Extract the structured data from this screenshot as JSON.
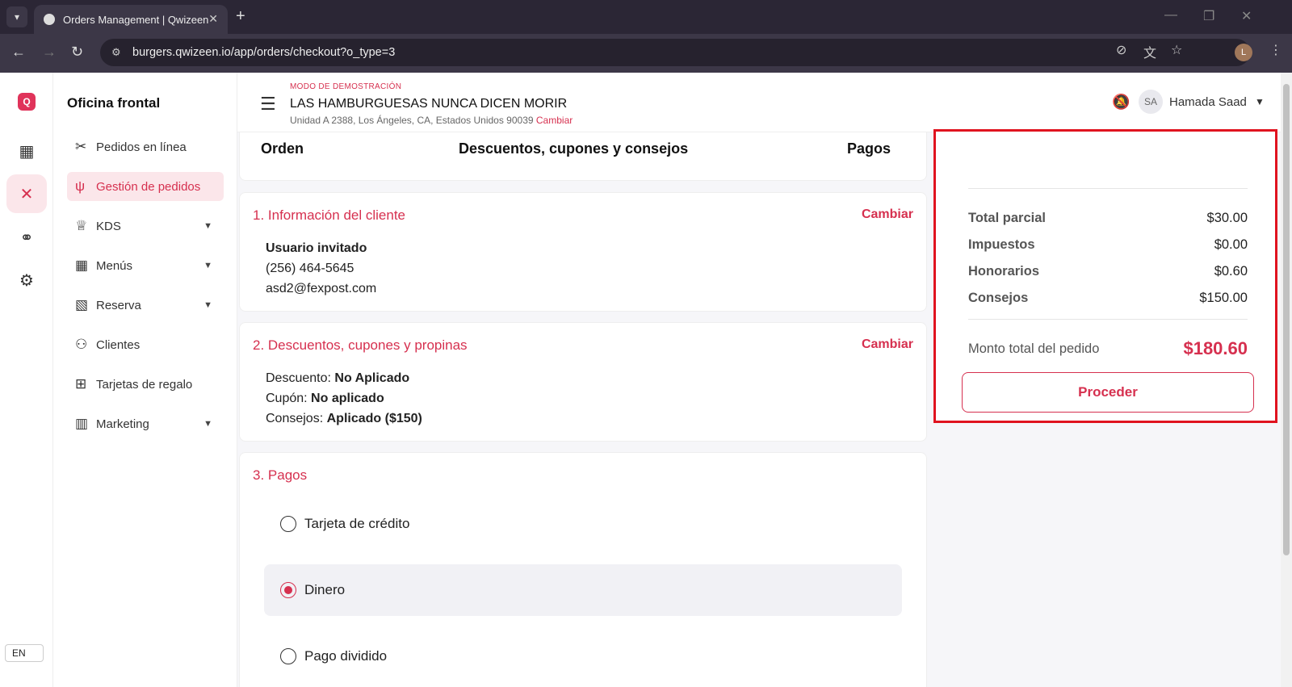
{
  "browser": {
    "tab_title": "Orders Management | Qwizeen",
    "url": "burgers.qwizeen.io/app/orders/checkout?o_type=3",
    "profile_initial": "L"
  },
  "rail": {
    "logo": "Q",
    "lang": "EN"
  },
  "sidenav": {
    "title": "Oficina frontal",
    "items": [
      {
        "label": "Pedidos en línea",
        "icon": "utensils-icon"
      },
      {
        "label": "Gestión de pedidos",
        "icon": "fork-knife-icon"
      },
      {
        "label": "KDS",
        "icon": "chef-hat-icon"
      },
      {
        "label": "Menús",
        "icon": "grid-icon"
      },
      {
        "label": "Reserva",
        "icon": "table-icon"
      },
      {
        "label": "Clientes",
        "icon": "users-icon"
      },
      {
        "label": "Tarjetas de regalo",
        "icon": "gift-icon"
      },
      {
        "label": "Marketing",
        "icon": "chart-icon"
      }
    ]
  },
  "header": {
    "demo_label": "MODO DE DEMOSTRACIÓN",
    "restaurant": "LAS HAMBURGUESAS NUNCA DICEN MORIR",
    "address": "Unidad A 2388, Los Ángeles, CA, Estados Unidos 90039",
    "change": "Cambiar",
    "user_initials": "SA",
    "user_name": "Hamada Saad"
  },
  "steps": {
    "order": "Orden",
    "discounts": "Descuentos, cupones y consejos",
    "payments": "Pagos"
  },
  "customer": {
    "title": "1. Información del cliente",
    "change": "Cambiar",
    "name": "Usuario invitado",
    "phone": "(256) 464-5645",
    "email": "asd2@fexpost.com"
  },
  "discounts": {
    "title": "2. Descuentos, cupones y propinas",
    "change": "Cambiar",
    "discount_label": "Descuento:",
    "discount_value": "No Aplicado",
    "coupon_label": "Cupón:",
    "coupon_value": "No aplicado",
    "tips_label": "Consejos:",
    "tips_value": "Aplicado ($150)"
  },
  "payments": {
    "title": "3. Pagos",
    "options": [
      {
        "label": "Tarjeta de crédito",
        "selected": false
      },
      {
        "label": "Dinero",
        "selected": true
      },
      {
        "label": "Pago dividido",
        "selected": false
      }
    ]
  },
  "summary": {
    "subtotal_label": "Total parcial",
    "subtotal": "$30.00",
    "taxes_label": "Impuestos",
    "taxes": "$0.00",
    "fees_label": "Honorarios",
    "fees": "$0.60",
    "tips_label": "Consejos",
    "tips": "$150.00",
    "total_label": "Monto total del pedido",
    "total": "$180.60",
    "proceed": "Proceder"
  },
  "colors": {
    "accent": "#d6304f",
    "highlight_border": "#e0131f"
  }
}
